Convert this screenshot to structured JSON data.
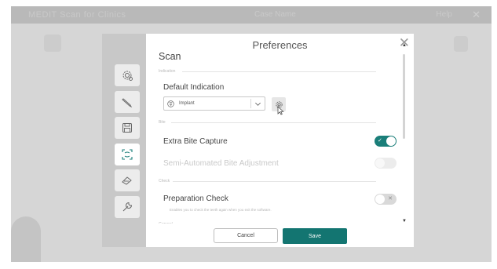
{
  "background_app": {
    "title": "MEDIT Scan for Clinics",
    "center_text": "Case Name",
    "right_text": "Help"
  },
  "modal": {
    "title": "Preferences",
    "section_header": "Scan",
    "groups": {
      "indication": "Indication",
      "bite": "Bite",
      "check": "Check",
      "general": "General"
    },
    "default_indication": {
      "label": "Default Indication",
      "selected": "Implant",
      "icon": "implant-icon"
    },
    "extra_bite_capture": {
      "label": "Extra Bite Capture",
      "state": "on"
    },
    "semi_automated_bite": {
      "label": "Semi-Automated Bite Adjustment",
      "state": "disabled"
    },
    "preparation_check": {
      "label": "Preparation Check",
      "description": "Enables you to check the teeth again when you exit the software.",
      "state": "off"
    },
    "tabs": [
      {
        "name": "general",
        "icon": "gear-icon"
      },
      {
        "name": "scan-tools",
        "icon": "pen-icon"
      },
      {
        "name": "data",
        "icon": "floppy-icon"
      },
      {
        "name": "scan",
        "icon": "scan-icon",
        "active": true
      },
      {
        "name": "cad",
        "icon": "brush-icon"
      },
      {
        "name": "hardware",
        "icon": "wrench-icon"
      }
    ]
  },
  "footer": {
    "cancel_label": "Cancel",
    "save_label": "Save"
  },
  "colors": {
    "accent": "#1a7e79",
    "save": "#137571"
  }
}
